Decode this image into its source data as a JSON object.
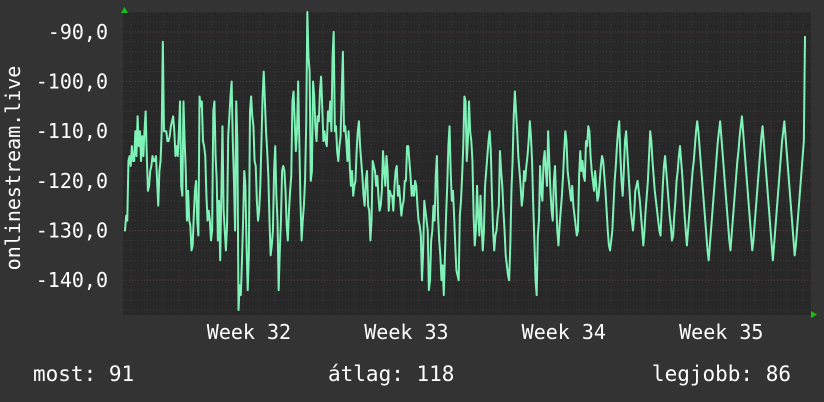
{
  "chart_data": {
    "type": "line",
    "title": "",
    "xlabel": "",
    "ylabel": "onlinestream.live",
    "ylim": [
      -147,
      -94
    ],
    "yticks": [
      "-90,0",
      "-100,0",
      "-110,0",
      "-120,0",
      "-130,0",
      "-140,0"
    ],
    "ytick_values": [
      -90,
      -100,
      -110,
      -120,
      -130,
      -140
    ],
    "xtick_labels": [
      "Week 32",
      "Week 33",
      "Week 34",
      "Week 35"
    ],
    "xtick_positions": [
      1.0,
      2.0,
      3.0,
      4.0
    ],
    "x_range": [
      0.2,
      4.57
    ],
    "grid": true,
    "legend": "none",
    "series": [
      {
        "values": [
          -130,
          -127,
          -128,
          -116,
          -115,
          -117,
          -113,
          -116,
          -116,
          -110,
          -115,
          -107,
          -113,
          -110,
          -116,
          -111,
          -115,
          -110,
          -106,
          -115,
          -122,
          -121,
          -118,
          -117,
          -115,
          -116,
          -116,
          -115,
          -120,
          -125,
          -118,
          -116,
          -110,
          -92,
          -110,
          -110,
          -110,
          -112,
          -112,
          -111,
          -109,
          -108,
          -107,
          -110,
          -115,
          -113,
          -115,
          -110,
          -104,
          -121,
          -123,
          -104,
          -112,
          -118,
          -128,
          -122,
          -128,
          -129,
          -134,
          -133,
          -127,
          -122,
          -120,
          -128,
          -131,
          -103,
          -105,
          -104,
          -112,
          -113,
          -115,
          -123,
          -128,
          -126,
          -128,
          -132,
          -130,
          -106,
          -104,
          -115,
          -120,
          -132,
          -124,
          -136,
          -123,
          -109,
          -126,
          -130,
          -134,
          -129,
          -111,
          -107,
          -103,
          -100,
          -112,
          -120,
          -130,
          -104,
          -112,
          -146,
          -141,
          -143,
          -136,
          -128,
          -118,
          -121,
          -133,
          -142,
          -135,
          -106,
          -103,
          -107,
          -109,
          -116,
          -117,
          -124,
          -128,
          -126,
          -121,
          -112,
          -103,
          -98,
          -104,
          -110,
          -114,
          -119,
          -128,
          -135,
          -133,
          -130,
          -118,
          -113,
          -123,
          -128,
          -142,
          -134,
          -128,
          -118,
          -117,
          -118,
          -122,
          -129,
          -132,
          -126,
          -122,
          -119,
          -104,
          -102,
          -108,
          -114,
          -110,
          -100,
          -112,
          -124,
          -132,
          -128,
          -125,
          -120,
          -109,
          -86,
          -95,
          -98,
          -120,
          -118,
          -100,
          -103,
          -109,
          -112,
          -107,
          -108,
          -102,
          -99,
          -105,
          -112,
          -110,
          -112,
          -113,
          -106,
          -108,
          -104,
          -110,
          -95,
          -90,
          -110,
          -109,
          -114,
          -116,
          -113,
          -111,
          -102,
          -94,
          -110,
          -109,
          -112,
          -116,
          -110,
          -117,
          -121,
          -118,
          -123,
          -121,
          -120,
          -114,
          -110,
          -108,
          -113,
          -116,
          -119,
          -123,
          -125,
          -120,
          -118,
          -125,
          -126,
          -132,
          -128,
          -116,
          -117,
          -118,
          -121,
          -119,
          -123,
          -126,
          -125,
          -122,
          -114,
          -118,
          -121,
          -115,
          -118,
          -126,
          -122,
          -123,
          -123,
          -126,
          -121,
          -118,
          -117,
          -123,
          -121,
          -124,
          -127,
          -125,
          -124,
          -120,
          -120,
          -113,
          -113,
          -116,
          -119,
          -123,
          -121,
          -123,
          -120,
          -121,
          -125,
          -128,
          -129,
          -131,
          -140,
          -134,
          -124,
          -126,
          -128,
          -130,
          -142,
          -140,
          -132,
          -130,
          -125,
          -128,
          -119,
          -115,
          -127,
          -132,
          -135,
          -140,
          -137,
          -143,
          -135,
          -127,
          -121,
          -113,
          -109,
          -118,
          -124,
          -122,
          -127,
          -133,
          -138,
          -139,
          -140,
          -127,
          -124,
          -119,
          -113,
          -103,
          -104,
          -116,
          -112,
          -104,
          -110,
          -112,
          -116,
          -127,
          -133,
          -130,
          -121,
          -127,
          -131,
          -123,
          -129,
          -134,
          -130,
          -121,
          -118,
          -115,
          -112,
          -110,
          -114,
          -123,
          -130,
          -134,
          -131,
          -130,
          -127,
          -125,
          -114,
          -118,
          -121,
          -126,
          -130,
          -135,
          -137,
          -139,
          -140,
          -133,
          -122,
          -116,
          -107,
          -102,
          -106,
          -110,
          -115,
          -118,
          -121,
          -125,
          -123,
          -118,
          -120,
          -117,
          -115,
          -112,
          -108,
          -111,
          -116,
          -125,
          -132,
          -140,
          -143,
          -131,
          -128,
          -117,
          -122,
          -124,
          -116,
          -114,
          -118,
          -121,
          -110,
          -116,
          -122,
          -126,
          -128,
          -120,
          -117,
          -124,
          -130,
          -133,
          -129,
          -126,
          -123,
          -119,
          -114,
          -110,
          -112,
          -118,
          -120,
          -122,
          -124,
          -121,
          -125,
          -127,
          -129,
          -131,
          -130,
          -119,
          -114,
          -118,
          -116,
          -119,
          -120,
          -112,
          -113,
          -109,
          -110,
          -115,
          -118,
          -120,
          -122,
          -118,
          -121,
          -124,
          -123,
          -120,
          -117,
          -115,
          -116,
          -119,
          -122,
          -126,
          -130,
          -133,
          -134,
          -132,
          -130,
          -125,
          -120,
          -117,
          -113,
          -110,
          -108,
          -115,
          -120,
          -123,
          -118,
          -112,
          -110,
          -114,
          -118,
          -122,
          -126,
          -128,
          -130,
          -127,
          -122,
          -121,
          -120,
          -122,
          -124,
          -127,
          -130,
          -133,
          -130,
          -126,
          -123,
          -120,
          -115,
          -110,
          -112,
          -116,
          -119,
          -122,
          -124,
          -126,
          -128,
          -130,
          -131,
          -126,
          -121,
          -117,
          -115,
          -118,
          -121,
          -124,
          -127,
          -129,
          -132,
          -131,
          -127,
          -124,
          -120,
          -118,
          -115,
          -113,
          -116,
          -119,
          -123,
          -127,
          -130,
          -133,
          -130,
          -127,
          -124,
          -121,
          -118,
          -116,
          -113,
          -110,
          -108,
          -110,
          -113,
          -116,
          -119,
          -122,
          -125,
          -128,
          -131,
          -134,
          -136,
          -133,
          -130,
          -127,
          -124,
          -121,
          -118,
          -115,
          -112,
          -110,
          -108,
          -111,
          -114,
          -117,
          -120,
          -123,
          -126,
          -129,
          -132,
          -134,
          -131,
          -128,
          -125,
          -122,
          -119,
          -116,
          -114,
          -111,
          -109,
          -107,
          -110,
          -113,
          -116,
          -119,
          -122,
          -125,
          -128,
          -131,
          -134,
          -132,
          -129,
          -126,
          -123,
          -120,
          -117,
          -114,
          -111,
          -109,
          -112,
          -115,
          -118,
          -121,
          -124,
          -127,
          -130,
          -133,
          -136,
          -133,
          -130,
          -127,
          -124,
          -121,
          -118,
          -115,
          -112,
          -110,
          -108,
          -111,
          -114,
          -117,
          -120,
          -123,
          -126,
          -129,
          -132,
          -135,
          -133,
          -130,
          -127,
          -124,
          -121,
          -118,
          -115,
          -112,
          -91
        ]
      }
    ]
  },
  "footer": {
    "now": "most: 91",
    "avg": "átlag: 118",
    "best": "legjobb: 86"
  },
  "colors": {
    "background": "#333333",
    "plot_background": "#282828",
    "line": "#7ff2b8",
    "grid": "#3c3c3c",
    "axis_arrow": "#19c019",
    "text": "#ffffff"
  }
}
